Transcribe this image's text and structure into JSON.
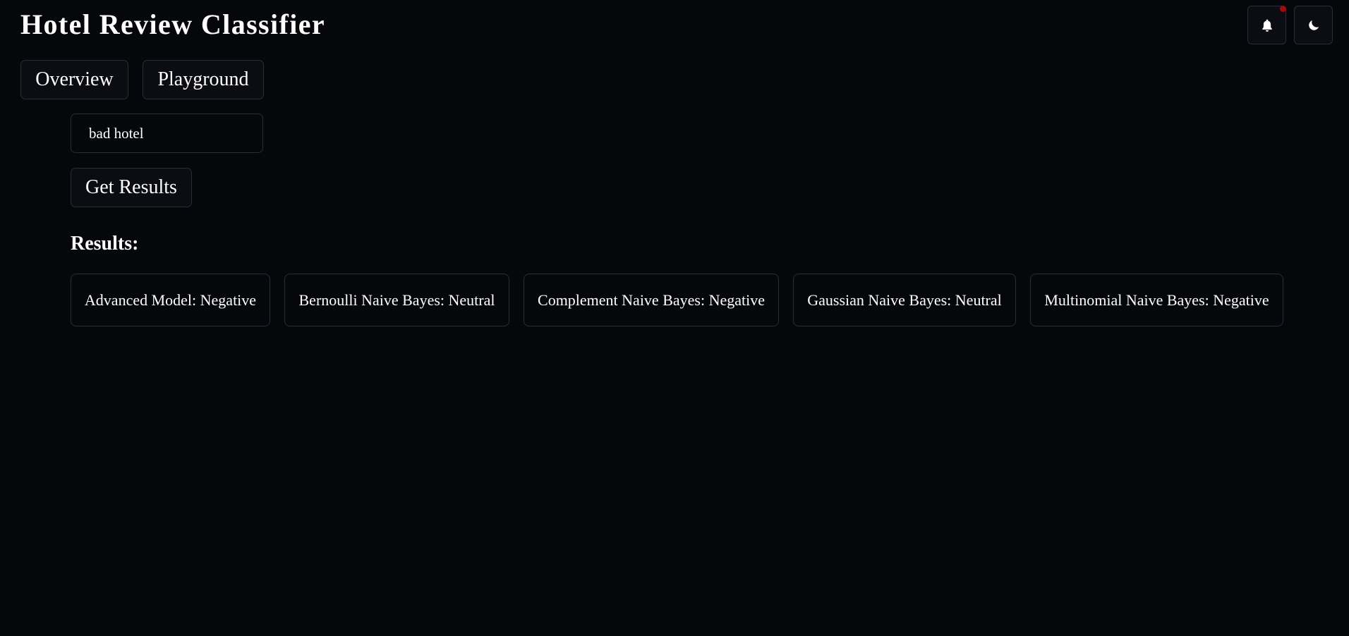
{
  "app": {
    "title": "Hotel Review Classifier"
  },
  "header": {
    "notification_icon": "bell-icon",
    "theme_icon": "moon-icon",
    "has_unread_notification": true,
    "notification_dot_color": "#a00d0d"
  },
  "tabs": {
    "overview_label": "Overview",
    "playground_label": "Playground"
  },
  "form": {
    "review_value": "bad hotel",
    "submit_label": "Get Results"
  },
  "results": {
    "heading": "Results:",
    "items": [
      {
        "label": "Advanced Model: Negative"
      },
      {
        "label": "Bernoulli Naive Bayes: Neutral"
      },
      {
        "label": "Complement Naive Bayes: Negative"
      },
      {
        "label": "Gaussian Naive Bayes: Neutral"
      },
      {
        "label": "Multinomial Naive Bayes: Negative"
      }
    ]
  },
  "colors": {
    "background": "#06070b",
    "surface": "#0b0d13",
    "border": "#2a2d36",
    "text": "#ffffff"
  }
}
